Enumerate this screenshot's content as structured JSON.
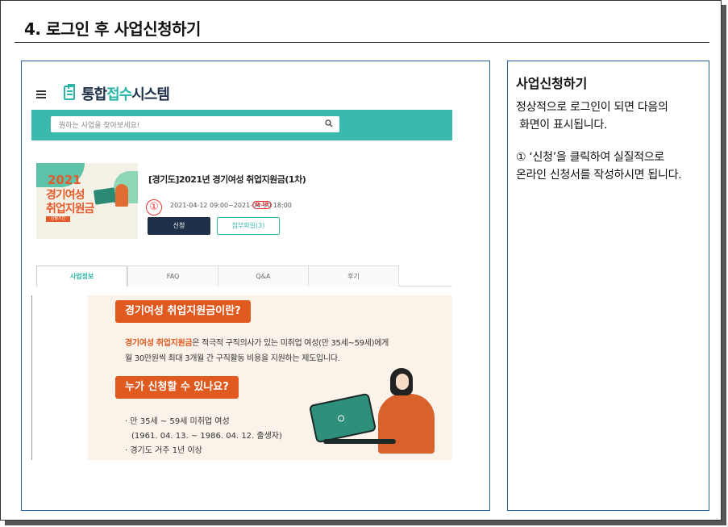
{
  "section_title": "4. 로그인 후 사업신청하기",
  "right_panel": {
    "title": "사업신청하기",
    "lines": [
      "정상적으로 로그인이 되면 다음의",
      " 화면이 표시됩니다.",
      "① ‘신청’을 클릭하여 실질적으로",
      "온라인 신청서를 작성하시면 됩니다."
    ]
  },
  "app": {
    "logo_part1": "통합",
    "logo_part2": "접수",
    "logo_part3": "시스템",
    "search_placeholder": "원하는 사업을 찾아보세요!",
    "poster": {
      "year": "2021",
      "line1": "경기여성",
      "line2": "취업지원금",
      "badge": "신청기간"
    },
    "item_title": "[경기도]2021년 경기여성 취업지원금(1차)",
    "date_range": "2021-04-12 09:00~2021-04-30 18:00",
    "d_badge": "D-18",
    "callout_number": "①",
    "apply_button": "신청",
    "attach_button": "첨부파일(3)",
    "tabs": [
      "사업정보",
      "FAQ",
      "Q&A",
      "후기"
    ],
    "content": {
      "heading1": "경기여성 취업지원금이란?",
      "desc_highlight": "경기여성 취업지원금",
      "desc_rest": "은 적극적 구직의사가 있는 미취업 여성(만 35세~59세)에게",
      "desc_line2": "월 30만원씩 최대 3개월 간 구직활동 비용을 지원하는 제도입니다.",
      "heading2": "누가 신청할 수 있나요?",
      "bullet1": "· 만 35세 ~ 59세 미취업 여성",
      "bullet1_sub": "(1961. 04. 13. ~ 1986. 04. 12. 출생자)",
      "bullet2": "· 경기도 거주 1년 이상"
    }
  },
  "colors": {
    "accent_teal": "#3cb9ad",
    "navy": "#1f3149",
    "orange": "#e0591f",
    "panel_border": "#2c5f9e",
    "callout_red": "#ee3333"
  }
}
